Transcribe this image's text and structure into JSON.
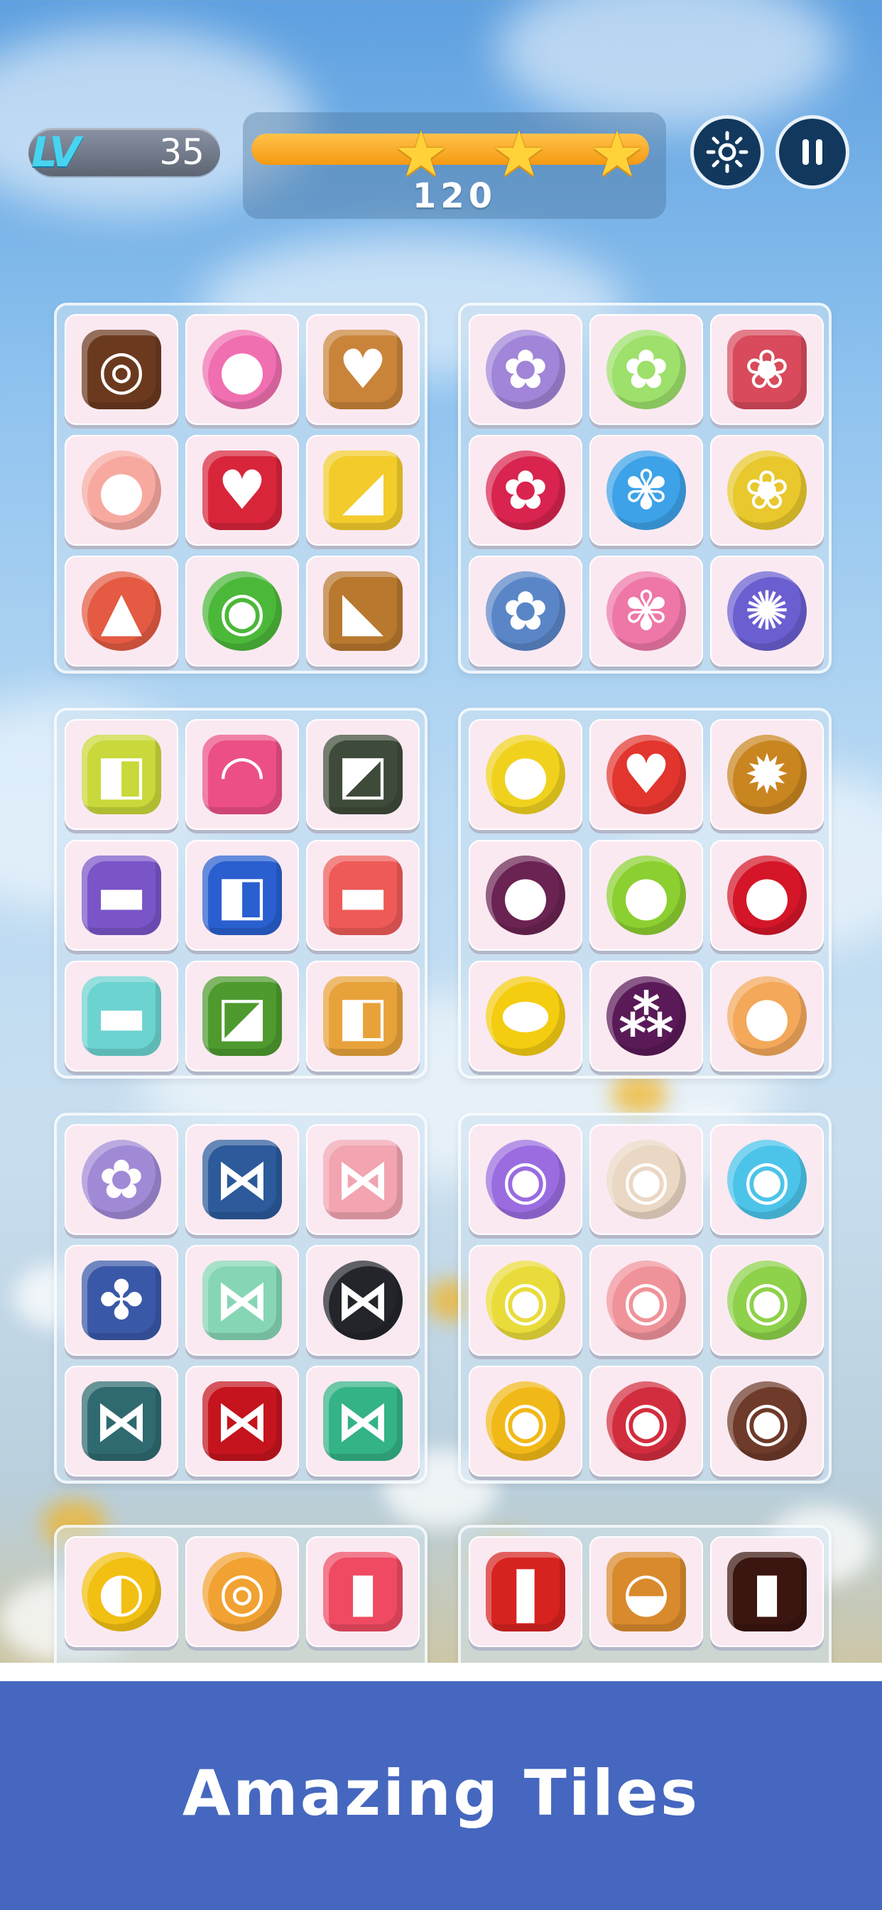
{
  "hud": {
    "level_prefix": "LV",
    "level": "35",
    "score": "120",
    "progress": 1.0,
    "stars_earned": 3,
    "star_glyph": "★",
    "settings_icon": "gear-icon",
    "pause_icon": "pause-icon"
  },
  "groups": [
    {
      "theme": "desserts",
      "tiles": [
        {
          "icon": "swiss-roll",
          "glyph": "◎",
          "color": "#6b3a1e"
        },
        {
          "icon": "cherry-cake",
          "glyph": "●",
          "color": "#f06fb0"
        },
        {
          "icon": "heart-tart",
          "glyph": "♥",
          "color": "#c9843a"
        },
        {
          "icon": "macaron",
          "glyph": "●",
          "color": "#f7a9a0"
        },
        {
          "icon": "heart-candy-box",
          "glyph": "♥",
          "color": "#d8253a"
        },
        {
          "icon": "cheese-wedge",
          "glyph": "◢",
          "color": "#f3cc2c"
        },
        {
          "icon": "rainbow-cake-slice",
          "glyph": "▲",
          "color": "#e45a43"
        },
        {
          "icon": "green-donut",
          "glyph": "◉",
          "color": "#4cb839"
        },
        {
          "icon": "pie-slice",
          "glyph": "◣",
          "color": "#b8782e"
        }
      ]
    },
    {
      "theme": "flowers",
      "tiles": [
        {
          "icon": "lilac-flower",
          "glyph": "✿",
          "color": "#a085d8"
        },
        {
          "icon": "green-rose",
          "glyph": "✿",
          "color": "#9de06b"
        },
        {
          "icon": "plum-blossom",
          "glyph": "❀",
          "color": "#d84a5c"
        },
        {
          "icon": "red-rose",
          "glyph": "✿",
          "color": "#d8244e"
        },
        {
          "icon": "blue-lily",
          "glyph": "✾",
          "color": "#3da2e8"
        },
        {
          "icon": "yellow-flowers",
          "glyph": "❀",
          "color": "#e8c82c"
        },
        {
          "icon": "blue-rose",
          "glyph": "✿",
          "color": "#5a86c8"
        },
        {
          "icon": "pink-lotus",
          "glyph": "✾",
          "color": "#ee77a8"
        },
        {
          "icon": "purple-flower",
          "glyph": "✺",
          "color": "#6a5ed0"
        }
      ]
    },
    {
      "theme": "sofas",
      "tiles": [
        {
          "icon": "yellow-armchair",
          "glyph": "◧",
          "color": "#c9d83a"
        },
        {
          "icon": "pink-curved-sofa",
          "glyph": "◠",
          "color": "#ec4f86"
        },
        {
          "icon": "green-black-chair",
          "glyph": "◩",
          "color": "#3f4b3a"
        },
        {
          "icon": "purple-sofa",
          "glyph": "▬",
          "color": "#7a55c8"
        },
        {
          "icon": "blue-armchair",
          "glyph": "◧",
          "color": "#2a5fd0"
        },
        {
          "icon": "red-sofa",
          "glyph": "▬",
          "color": "#ee5a58"
        },
        {
          "icon": "teal-sofa",
          "glyph": "▬",
          "color": "#6cd3d0"
        },
        {
          "icon": "green-corner-sofa",
          "glyph": "◪",
          "color": "#4e9a2e"
        },
        {
          "icon": "orange-armchair",
          "glyph": "◧",
          "color": "#e8a23a"
        }
      ]
    },
    {
      "theme": "fruits",
      "tiles": [
        {
          "icon": "pear",
          "glyph": "●",
          "color": "#f0d21e"
        },
        {
          "icon": "strawberry",
          "glyph": "♥",
          "color": "#e2352e"
        },
        {
          "icon": "durian",
          "glyph": "✹",
          "color": "#c98520"
        },
        {
          "icon": "blackberry",
          "glyph": "●",
          "color": "#6a2352"
        },
        {
          "icon": "lime",
          "glyph": "●",
          "color": "#8ccf30"
        },
        {
          "icon": "cherries",
          "glyph": "●",
          "color": "#d41628"
        },
        {
          "icon": "lemon",
          "glyph": "⬬",
          "color": "#f4cc10"
        },
        {
          "icon": "grapes",
          "glyph": "⁂",
          "color": "#5a1a58"
        },
        {
          "icon": "peach",
          "glyph": "●",
          "color": "#f3a85a"
        }
      ]
    },
    {
      "theme": "bows",
      "tiles": [
        {
          "icon": "lavender-flower-brooch",
          "glyph": "✿",
          "color": "#a08ad6"
        },
        {
          "icon": "navy-bow",
          "glyph": "⋈",
          "color": "#2c5a9a"
        },
        {
          "icon": "pink-bow",
          "glyph": "⋈",
          "color": "#f2a4b0"
        },
        {
          "icon": "purple-blue-bow",
          "glyph": "✤",
          "color": "#3a58a8"
        },
        {
          "icon": "mint-bow",
          "glyph": "⋈",
          "color": "#86d6b6"
        },
        {
          "icon": "black-pearl-bow",
          "glyph": "⋈",
          "color": "#23252b"
        },
        {
          "icon": "teal-bow",
          "glyph": "⋈",
          "color": "#2f6a70"
        },
        {
          "icon": "red-bow",
          "glyph": "⋈",
          "color": "#c5141e"
        },
        {
          "icon": "green-charm-bow",
          "glyph": "⋈",
          "color": "#34b386"
        }
      ]
    },
    {
      "theme": "donuts",
      "tiles": [
        {
          "icon": "purple-donut",
          "glyph": "◉",
          "color": "#9a6ce0"
        },
        {
          "icon": "white-sprinkle-donut",
          "glyph": "◉",
          "color": "#ead7c4"
        },
        {
          "icon": "blue-donut",
          "glyph": "◉",
          "color": "#4cc4ea"
        },
        {
          "icon": "yellow-donut",
          "glyph": "◉",
          "color": "#e9dc3a"
        },
        {
          "icon": "pink-donut",
          "glyph": "◉",
          "color": "#f0929a"
        },
        {
          "icon": "green-sprinkle-donut",
          "glyph": "◉",
          "color": "#8ed14a"
        },
        {
          "icon": "chocolate-yellow-donut",
          "glyph": "◉",
          "color": "#f1b918"
        },
        {
          "icon": "red-donut",
          "glyph": "◉",
          "color": "#d22d3e"
        },
        {
          "icon": "brown-pink-donut",
          "glyph": "◉",
          "color": "#6e3a2a"
        }
      ]
    },
    {
      "theme": "beach",
      "tiles": [
        {
          "icon": "volleyball",
          "glyph": "◐",
          "color": "#f2c012"
        },
        {
          "icon": "swim-ring",
          "glyph": "◎",
          "color": "#f1a232"
        },
        {
          "icon": "popsicle",
          "glyph": "▮",
          "color": "#ef4a62"
        }
      ]
    },
    {
      "theme": "fast-food",
      "tiles": [
        {
          "icon": "french-fries",
          "glyph": "❚",
          "color": "#d6231f"
        },
        {
          "icon": "burger",
          "glyph": "◒",
          "color": "#d98a2c"
        },
        {
          "icon": "cola-glass",
          "glyph": "▮",
          "color": "#3b1510"
        }
      ]
    }
  ],
  "banner": {
    "title": "Amazing Tiles"
  }
}
